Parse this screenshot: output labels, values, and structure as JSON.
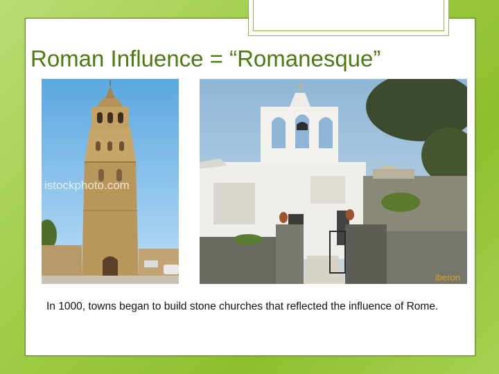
{
  "slide": {
    "title": "Roman Influence = “Romanesque”",
    "caption": "In 1000, towns began to build stone churches that reflected the influence of Rome.",
    "photo_left": {
      "subject": "stone-bell-tower",
      "watermark": "istockphoto.com"
    },
    "photo_right": {
      "subject": "white-stone-church",
      "credit": "iberon"
    }
  },
  "colors": {
    "title": "#4d7a10",
    "background": "#9fcc45",
    "slide": "#ffffff"
  }
}
